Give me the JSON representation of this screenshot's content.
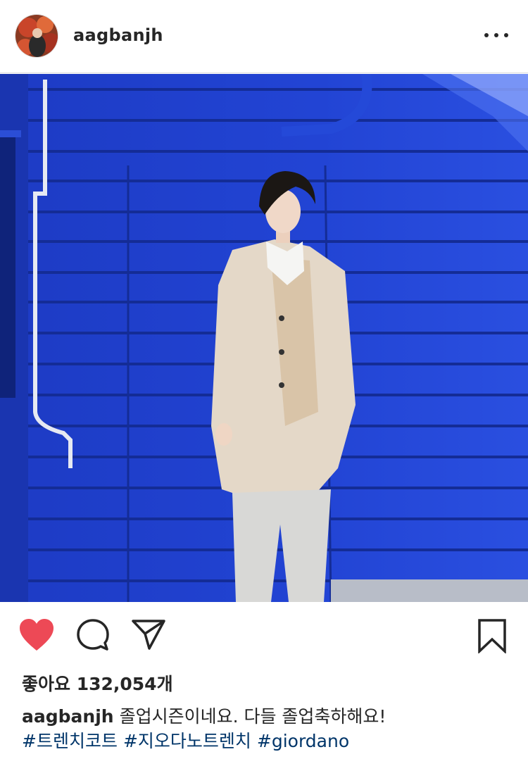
{
  "post": {
    "username": "aagbanjh",
    "likes_text": "좋아요 132,054개",
    "caption_user": "aagbanjh",
    "caption_text": "졸업시즌이네요. 다들 졸업축하해요!",
    "hashtags": [
      "#트렌치코트",
      "#지오다노트렌치",
      "#giordano"
    ]
  },
  "icons": {
    "more": "more-options-icon",
    "like": "heart-icon",
    "comment": "comment-icon",
    "share": "send-icon",
    "save": "bookmark-icon"
  },
  "colors": {
    "like_active": "#ed4956",
    "hashtag": "#003569",
    "wall": "#1f3fc8"
  }
}
